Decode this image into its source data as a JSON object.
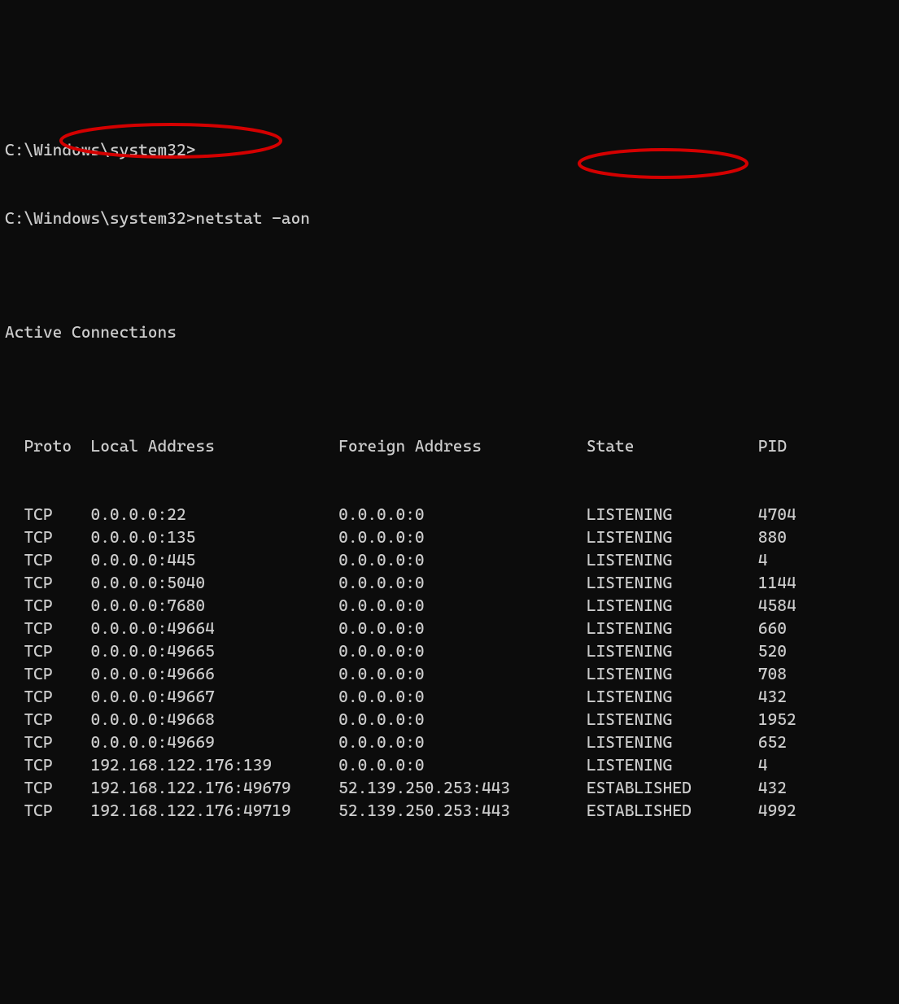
{
  "prompt1": "C:\\Windows\\system32>",
  "prompt2": "C:\\Windows\\system32>",
  "command": "netstat -aon",
  "blank": "",
  "heading": "Active Connections",
  "header": {
    "proto": "  Proto",
    "local": "Local Address",
    "foreign": "Foreign Address",
    "state": "State",
    "pid": "PID"
  },
  "rows": [
    {
      "proto": "  TCP",
      "local": "0.0.0.0:22",
      "foreign": "0.0.0.0:0",
      "state": "LISTENING",
      "pid": "4704"
    },
    {
      "proto": "  TCP",
      "local": "0.0.0.0:135",
      "foreign": "0.0.0.0:0",
      "state": "LISTENING",
      "pid": "880"
    },
    {
      "proto": "  TCP",
      "local": "0.0.0.0:445",
      "foreign": "0.0.0.0:0",
      "state": "LISTENING",
      "pid": "4"
    },
    {
      "proto": "  TCP",
      "local": "0.0.0.0:5040",
      "foreign": "0.0.0.0:0",
      "state": "LISTENING",
      "pid": "1144"
    },
    {
      "proto": "  TCP",
      "local": "0.0.0.0:7680",
      "foreign": "0.0.0.0:0",
      "state": "LISTENING",
      "pid": "4584"
    },
    {
      "proto": "  TCP",
      "local": "0.0.0.0:49664",
      "foreign": "0.0.0.0:0",
      "state": "LISTENING",
      "pid": "660"
    },
    {
      "proto": "  TCP",
      "local": "0.0.0.0:49665",
      "foreign": "0.0.0.0:0",
      "state": "LISTENING",
      "pid": "520"
    },
    {
      "proto": "  TCP",
      "local": "0.0.0.0:49666",
      "foreign": "0.0.0.0:0",
      "state": "LISTENING",
      "pid": "708"
    },
    {
      "proto": "  TCP",
      "local": "0.0.0.0:49667",
      "foreign": "0.0.0.0:0",
      "state": "LISTENING",
      "pid": "432"
    },
    {
      "proto": "  TCP",
      "local": "0.0.0.0:49668",
      "foreign": "0.0.0.0:0",
      "state": "LISTENING",
      "pid": "1952"
    },
    {
      "proto": "  TCP",
      "local": "0.0.0.0:49669",
      "foreign": "0.0.0.0:0",
      "state": "LISTENING",
      "pid": "652"
    },
    {
      "proto": "  TCP",
      "local": "192.168.122.176:139",
      "foreign": "0.0.0.0:0",
      "state": "LISTENING",
      "pid": "4"
    },
    {
      "proto": "  TCP",
      "local": "192.168.122.176:49679",
      "foreign": "52.139.250.253:443",
      "state": "ESTABLISHED",
      "pid": "432"
    },
    {
      "proto": "  TCP",
      "local": "192.168.122.176:49719",
      "foreign": "52.139.250.253:443",
      "state": "ESTABLISHED",
      "pid": "4992"
    }
  ]
}
